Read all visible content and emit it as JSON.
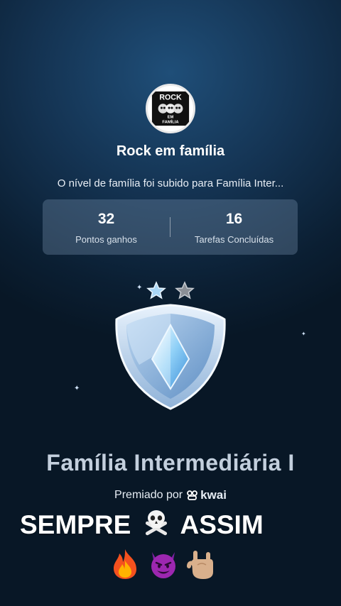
{
  "family": {
    "avatar_text_top": "ROCK",
    "avatar_text_mid": "EM",
    "avatar_text_bottom": "FAMÍLIA",
    "name": "Rock em família"
  },
  "level_message": "O nível de família foi subido para Família Inter...",
  "stats": [
    {
      "value": "32",
      "label": "Pontos ganhos"
    },
    {
      "value": "16",
      "label": "Tarefas Concluídas"
    }
  ],
  "badge": {
    "stars_filled": 1,
    "stars_total": 2,
    "title": "Família Intermediária I"
  },
  "awarded": {
    "prefix": "Premiado por",
    "brand": "kwai"
  },
  "caption": {
    "word1": "SEMPRE",
    "word2": "ASSIM",
    "emojis": [
      "fire-emoji",
      "smiling-devil-emoji",
      "rock-on-hand-emoji"
    ]
  },
  "colors": {
    "background_top": "#1f4e78",
    "background_bottom": "#081726",
    "stats_panel": "#5a7596",
    "badge_title": "#c3cfdd"
  }
}
